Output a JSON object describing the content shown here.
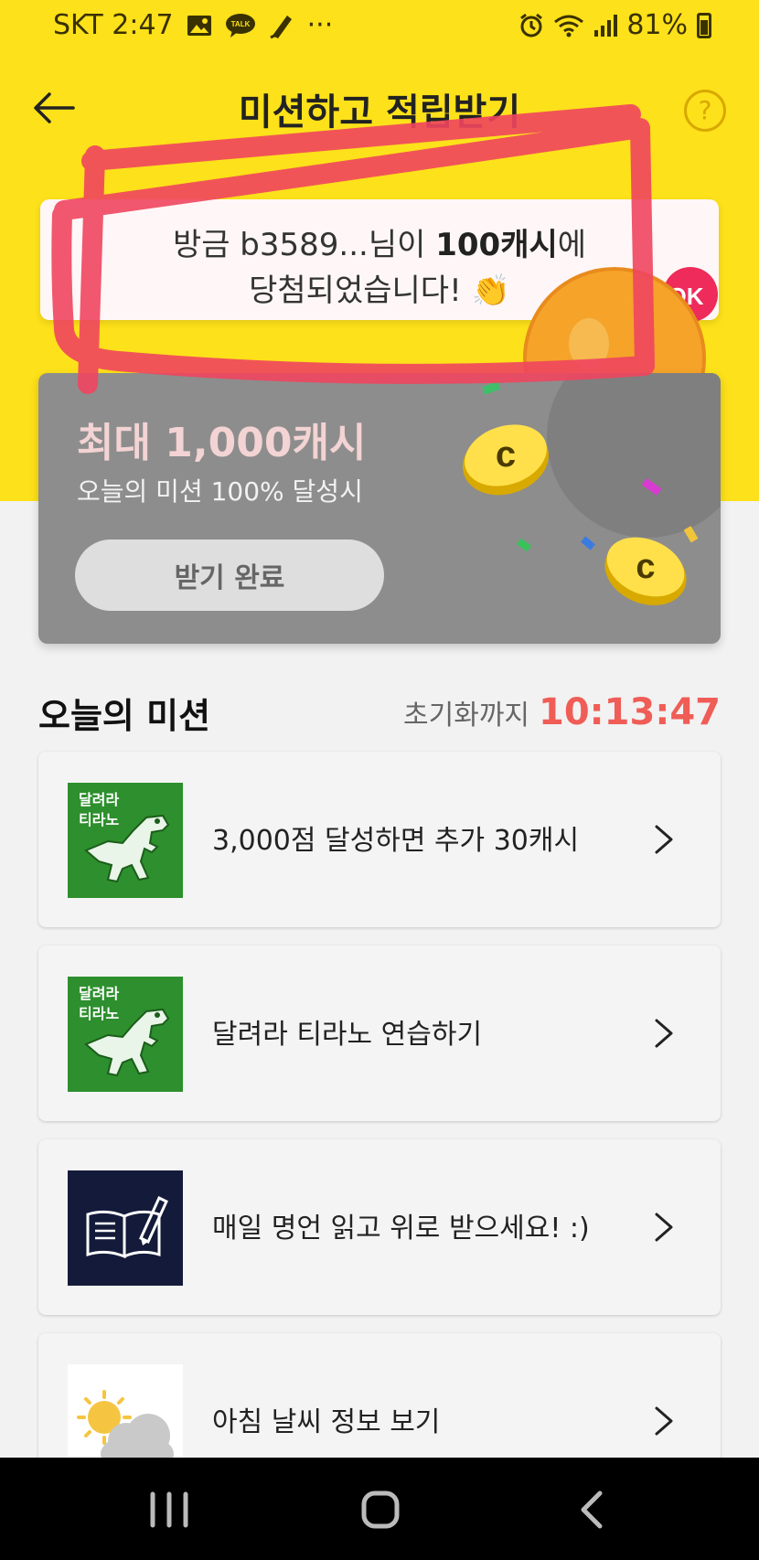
{
  "status_bar": {
    "carrier_time": "SKT 2:47",
    "talk_badge": "TALK",
    "more": "···",
    "battery": "81%"
  },
  "header": {
    "title": "미션하고 적립받기",
    "help": "?"
  },
  "ticker": {
    "prefix": "방금 b3589...님이 ",
    "amount": "100캐시",
    "suffix": "에",
    "line2": "당첨되었습니다! 👏"
  },
  "reward_card": {
    "title": "최대 1,000캐시",
    "subtitle": "오늘의 미션 100% 달성시",
    "button": "받기 완료",
    "badge": "OK",
    "coin_letter": "c"
  },
  "missions": {
    "title": "오늘의 미션",
    "reset_label": "초기화까지",
    "reset_time": "10:13:47",
    "items": [
      {
        "label": "3,000점 달성하면 추가 30캐시",
        "icon": "dino-game-icon",
        "thumb_text_1": "달려라",
        "thumb_text_2": "티라노"
      },
      {
        "label": "달려라 티라노 연습하기",
        "icon": "dino-game-icon",
        "thumb_text_1": "달려라",
        "thumb_text_2": "티라노"
      },
      {
        "label": "매일 명언 읽고 위로 받으세요! :)",
        "icon": "book-pen-icon"
      },
      {
        "label": "아침 날씨 정보 보기",
        "icon": "weather-icon"
      }
    ]
  },
  "colors": {
    "brand_yellow": "#fde11a",
    "timer_red": "#ef5d56",
    "card_gray": "#8d8d8d",
    "tile_green": "#2d8f2d",
    "tile_navy": "#141b3a"
  }
}
